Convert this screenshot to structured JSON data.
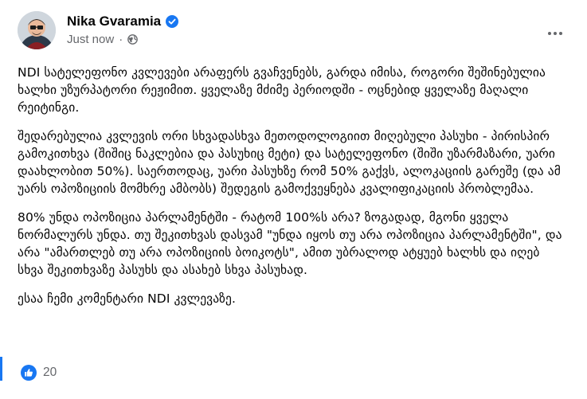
{
  "post": {
    "author": {
      "name": "Nika Gvaramia",
      "verified_icon": "verified-badge-icon",
      "avatar_icon": "avatar-photo"
    },
    "meta": {
      "timestamp": "Just now",
      "separator": "·",
      "audience_icon": "globe-icon"
    },
    "more_icon": "more-options-icon",
    "paragraphs": [
      "NDI სატელეფონო კვლევები არაფერს გვაჩვენებს, გარდა იმისა, როგორი შეშინებულია ხალხი უზურპატორი რეჟიმით. ყველაზე მძიმე პერიოდში - ოცნებიდ ყველაზე მაღალი რეიტინგი.",
      "შედარებულია კვლევის ორი სხვადასხვა მეთოდოლოგიით მიღებული პასუხი - პირისპირ გამოკითხვა (შიშიც ნაკლებია და პასუხიც მეტი) და სატელეფონო (შიში უზარმაზარი, უარი დაახლობით 50%). საერთოდაც, უარი პასუხზე რომ 50% გაქვს, ალოკაციის გარეშე (და ამ უარს ოპოზიციის მომხრე ამბობს) შედეგის გამოქვეყნება კვალიფიკაციის პრობლემაა.",
      "80% უნდა ოპოზიცია პარლამენტში - რატომ 100%ს არა? ზოგადად, მგონი ყველა ნორმალურს უნდა. თუ შეკითხვას დასვამ \"უნდა იყოს თუ არა ოპოზიცია პარლამენტში\", და არა \"ამართლებ თუ არა ოპოზიციის ბოიკოტს\", ამით უბრალოდ ატყუებ ხალხს და იღებ სხვა შეკითხვაზე პასუხს და ასახებ სხვა პასუხად.",
      "ესაა ჩემი კომენტარი NDI კვლევაზე."
    ],
    "reactions": {
      "icon": "like-icon",
      "count": "20"
    },
    "colors": {
      "accent": "#1877f2",
      "secondary_text": "#65676b",
      "primary_text": "#050505"
    }
  }
}
